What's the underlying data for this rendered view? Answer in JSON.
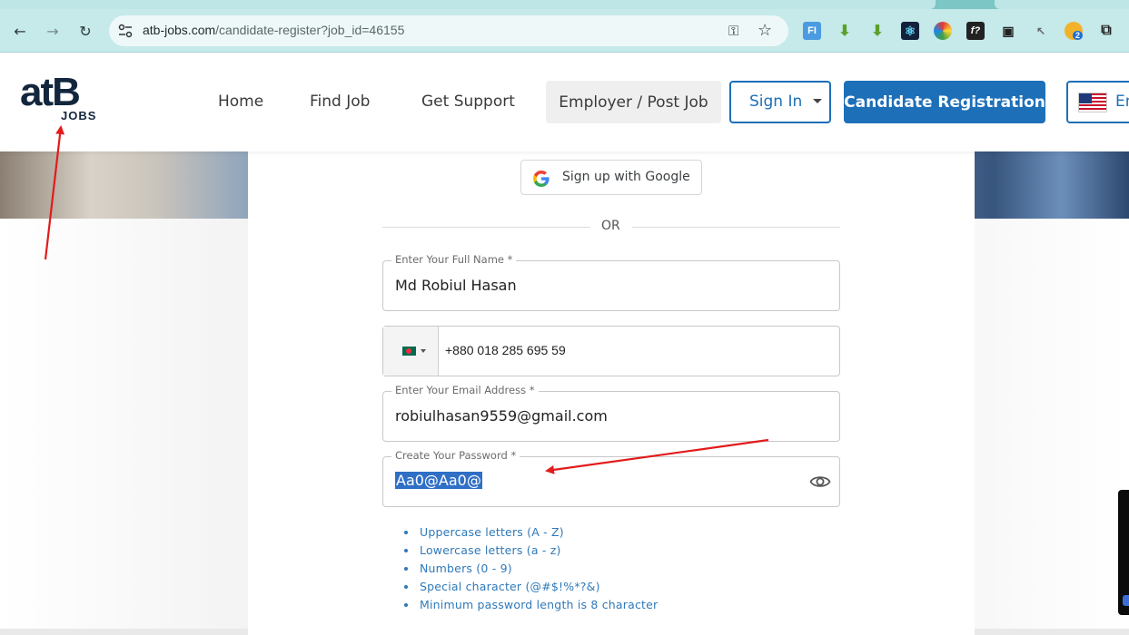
{
  "browser": {
    "url_host": "atb-jobs.com",
    "url_path": "/candidate-register?job_id=46155",
    "extension_badge": "2",
    "extensions": [
      "fi-extension-icon",
      "download-arrow-icon",
      "download-arrow-icon",
      "react-icon",
      "color-wheel-icon",
      "font-icon",
      "picture-in-picture-icon",
      "pointer-icon",
      "notification-icon",
      "puzzle-icon"
    ]
  },
  "header": {
    "logo_main": "atB",
    "logo_sub": "JOBS",
    "nav": [
      "Home",
      "Find Job",
      "Get Support"
    ],
    "employer_button": "Employer / Post Job",
    "signin_button": "Sign In",
    "candidate_button": "Candidate Registration",
    "language_button": "En"
  },
  "form": {
    "google_button": "Sign up with Google",
    "or_text": "OR",
    "full_name": {
      "label": "Enter Your Full Name *",
      "value": "Md Robiul Hasan"
    },
    "phone": {
      "country": "bangladesh-flag-icon",
      "value": "+880 018 285 695 59"
    },
    "email": {
      "label": "Enter Your Email Address *",
      "value": "robiulhasan9559@gmail.com"
    },
    "password": {
      "label": "Create Your Password *",
      "value": "Aa0@Aa0@"
    },
    "rules": [
      "Uppercase letters (A - Z)",
      "Lowercase letters (a - z)",
      "Numbers (0 - 9)",
      "Special character (@#$!%*?&)",
      "Minimum password length is 8 character"
    ]
  },
  "colors": {
    "brand_blue": "#1d6fb8",
    "rule_text": "#2f79b9",
    "annotation_red": "#e21b1b",
    "selection": "#2f6fc6"
  }
}
